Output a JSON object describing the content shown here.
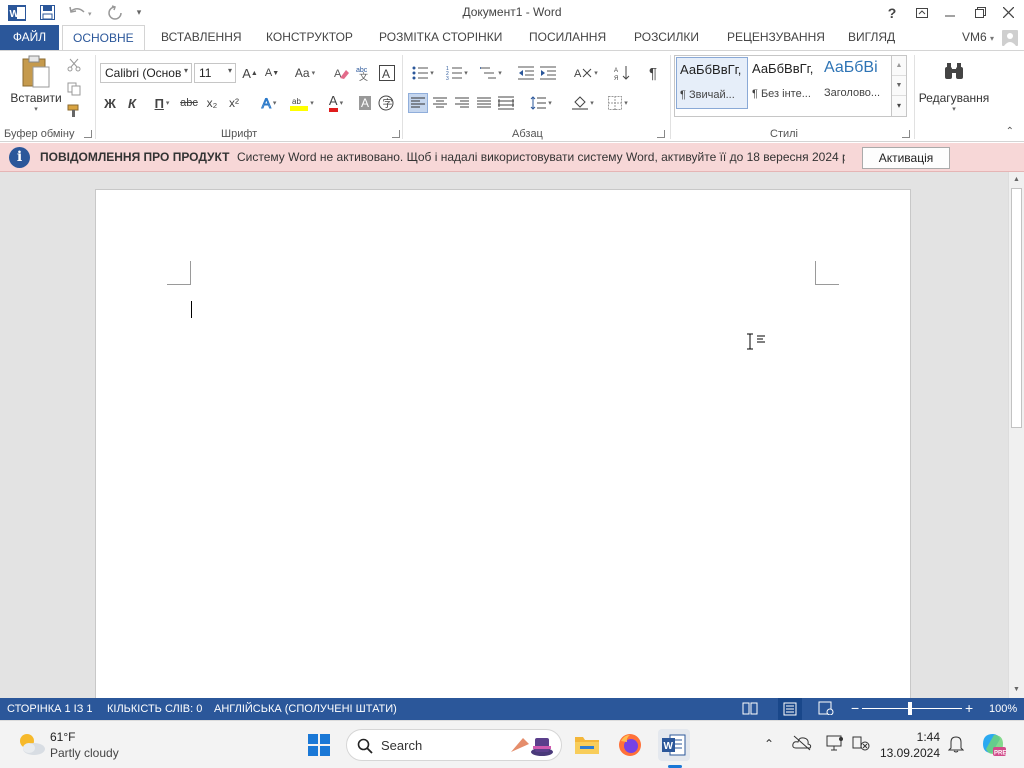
{
  "titlebar": {
    "title": "Документ1 - Word",
    "help_glyph": "?"
  },
  "tabs": {
    "file": "ФАЙЛ",
    "items": [
      "ОСНОВНЕ",
      "ВСТАВЛЕННЯ",
      "КОНСТРУКТОР",
      "РОЗМІТКА СТОРІНКИ",
      "ПОСИЛАННЯ",
      "РОЗСИЛКИ",
      "РЕЦЕНЗУВАННЯ",
      "ВИГЛЯД"
    ],
    "active": "ОСНОВНЕ",
    "user": "VM6"
  },
  "ribbon": {
    "clipboard": {
      "paste_label": "Вставити",
      "group_label": "Буфер обміну"
    },
    "font": {
      "font_name": "Calibri (Основ",
      "font_size": "11",
      "grow": "A",
      "shrink": "A",
      "change_case": "Aa",
      "bold": "Ж",
      "italic": "К",
      "underline": "П",
      "strike": "abc",
      "subscript": "x₂",
      "superscript": "x²",
      "text_effect": "A",
      "font_color": "A",
      "char_shading": "A",
      "group_label": "Шрифт"
    },
    "paragraph": {
      "pilcrow": "¶",
      "group_label": "Абзац"
    },
    "styles": {
      "items": [
        {
          "sample": "АаБбВвГг,",
          "name": "¶ Звичай..."
        },
        {
          "sample": "АаБбВвГг,",
          "name": "¶ Без інте..."
        },
        {
          "sample": "АаБбВі",
          "name": "Заголово..."
        }
      ],
      "group_label": "Стилі"
    },
    "editing": {
      "label": "Редагування"
    }
  },
  "notification": {
    "title": "ПОВІДОМЛЕННЯ ПРО ПРОДУКТ",
    "message": "Систему Word не активовано. Щоб і надалі використовувати систему Word, активуйте її до 18 вересня 2024 р..",
    "button": "Активація",
    "info_glyph": "i"
  },
  "statusbar": {
    "page": "СТОРІНКА 1 ІЗ 1",
    "words": "КІЛЬКІСТЬ СЛІВ: 0",
    "language": "АНГЛІЙСЬКА (СПОЛУЧЕНІ ШТАТИ)",
    "zoom": "100%",
    "zoom_out": "−",
    "zoom_in": "+"
  },
  "taskbar": {
    "weather_temp": "61°F",
    "weather_desc": "Partly cloudy",
    "search_label": "Search",
    "time": "1:44",
    "date": "13.09.2024"
  },
  "colors": {
    "accent": "#2b579a",
    "notification_bg": "#f7d7d7",
    "page_bg": "#e3e3e3"
  }
}
